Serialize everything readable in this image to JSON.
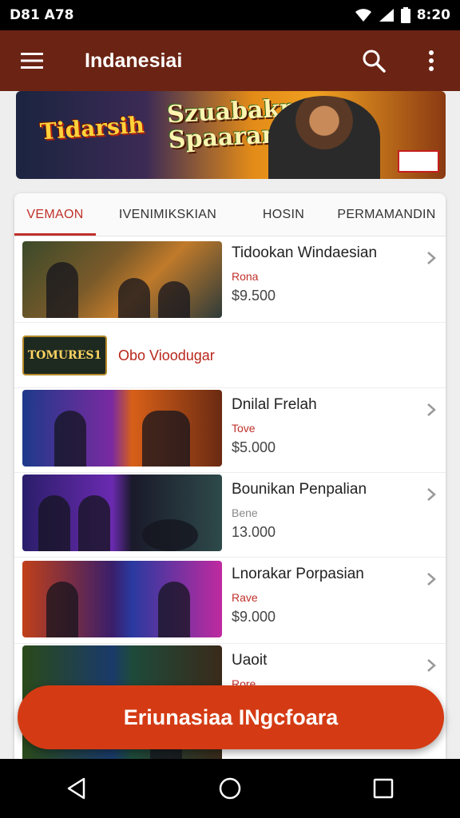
{
  "status_bar": {
    "left_text": "D81 A78",
    "time": "8:20"
  },
  "app_bar": {
    "title": "Indanesiai",
    "icons": [
      "hamburger-menu-icon",
      "search-icon",
      "more-vert-icon"
    ]
  },
  "banner": {
    "logo_left": "Tidarsih",
    "logo_main": "Szuabakn Spaarani",
    "badge": ""
  },
  "tabs": [
    {
      "label": "VEMAON",
      "active": true
    },
    {
      "label": "IVENIMIKSKIAN",
      "active": false
    },
    {
      "label": "HOSIN",
      "active": false
    },
    {
      "label": "PERMAMANDIN",
      "active": false
    }
  ],
  "items": [
    {
      "title": "Tidookan Windaesian",
      "sub": "Rona",
      "price": "$9.500"
    },
    {
      "title": "Dnilal Frelah",
      "sub": "Tove",
      "price": "$5.000"
    },
    {
      "title": "Bounikan Penpalian",
      "sub": "Bene",
      "price": "13.000"
    },
    {
      "title": "Lnorakar Porpasian",
      "sub": "Rave",
      "price": "$9.000"
    },
    {
      "title": "Uaoit",
      "sub": "Rore",
      "price": ""
    }
  ],
  "promo": {
    "logo_text": "TOMURES1",
    "text": "Obo Vioodugar"
  },
  "cta": {
    "label": "Eriunasiaa INgcfoara"
  },
  "colors": {
    "app_bar": "#6b2313",
    "accent": "#c0312a",
    "cta": "#d43b14"
  }
}
